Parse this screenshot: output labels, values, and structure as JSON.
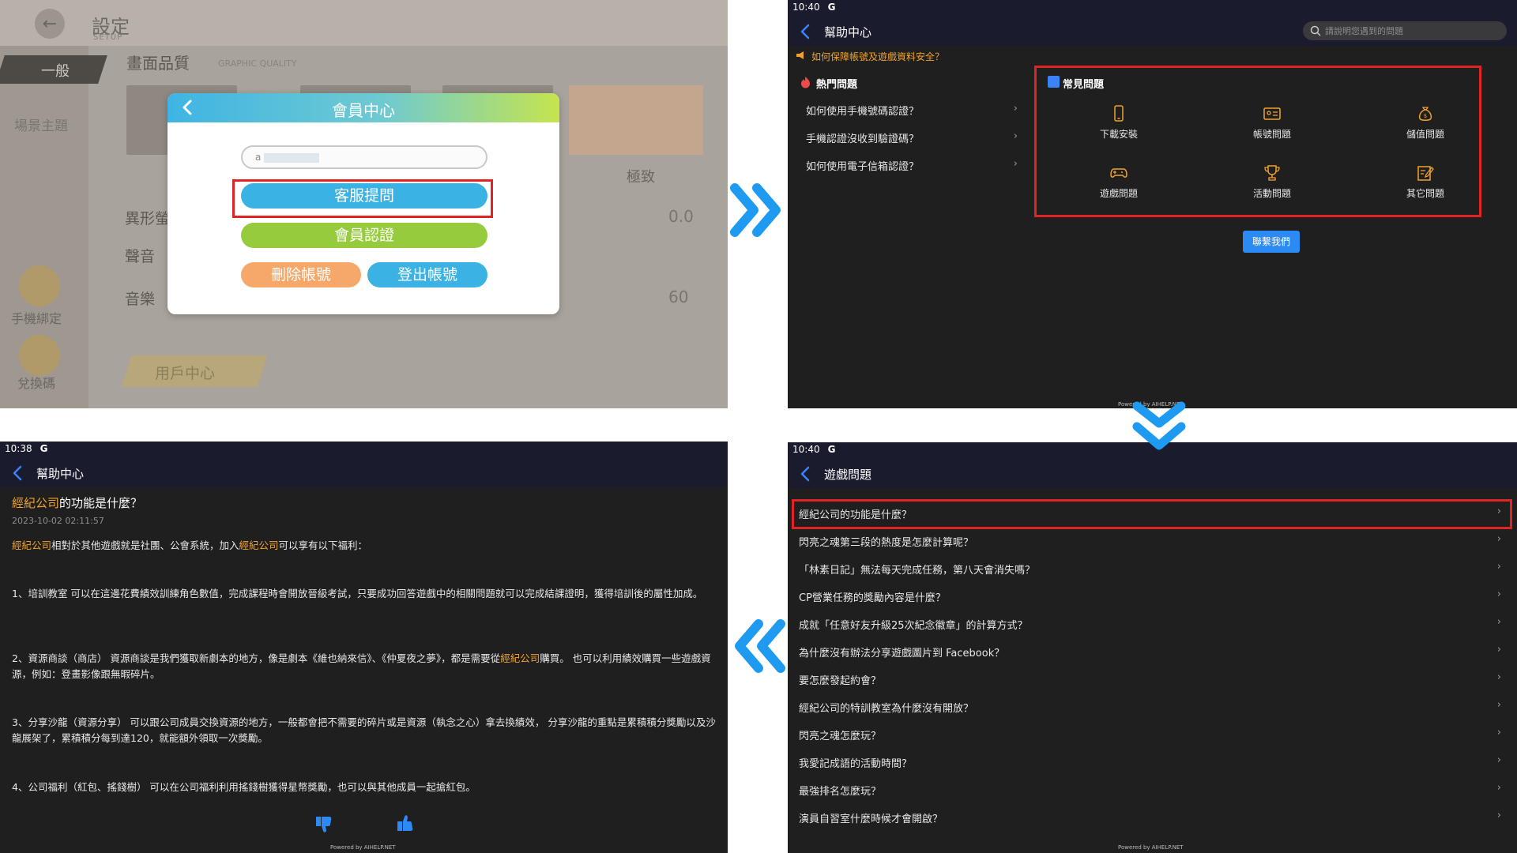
{
  "panel1": {
    "settings_title": "設定",
    "settings_sub": "SETUP",
    "nav_general": "一般",
    "nav_scene": "場景主題",
    "side_phone": "手機綁定",
    "side_redeem": "兌換碼",
    "section_title": "畫面品質",
    "section_sub": "GRAPHIC QUALITY",
    "quality_option": "極致",
    "rows": [
      {
        "label": "異形螢",
        "value": "0.0"
      },
      {
        "label": "聲音",
        "value": ""
      },
      {
        "label": "音樂",
        "value": "60"
      }
    ],
    "user_center": "用戶中心",
    "dialog": {
      "title": "會員中心",
      "account_prefix": "a",
      "btn_support": "客服提問",
      "btn_verify": "會員認證",
      "btn_delete": "刪除帳號",
      "btn_logout": "登出帳號"
    }
  },
  "panel2": {
    "time": "10:40",
    "g": "G",
    "title": "幫助中心",
    "search_placeholder": "請說明您遇到的問題",
    "notice": "如何保障帳號及遊戲資料安全？",
    "hot_title": "熱門問題",
    "hot_items": [
      "如何使用手機號碼認證？",
      "手機認證沒收到驗證碼？",
      "如何使用電子信箱認證？"
    ],
    "faq_title": "常見問題",
    "faq": [
      "下載安裝",
      "帳號問題",
      "儲值問題",
      "遊戲問題",
      "活動問題",
      "其它問題"
    ],
    "contact": "聯繫我們",
    "powered": "Powered by AIHELP.NET"
  },
  "panel3": {
    "time": "10:38",
    "g": "G",
    "title": "幫助中心",
    "article_title_hl": "經紀公司",
    "article_title_rest": "的功能是什麼？",
    "date": "2023-10-02 02:11:57",
    "intro": {
      "a": "經紀公司",
      "b": "相對於其他遊戲就是社團、公會系統，加入",
      "c": "經紀公司",
      "d": "可以享有以下福利："
    },
    "p1": "1、培訓教室 可以在這邊花費績效訓練角色數值，完成課程時會開放晉級考試，只要成功回答遊戲中的相關問題就可以完成結課證明，獲得培訓後的屬性加成。",
    "p2a": "2、資源商談（商店） 資源商談是我們獲取新劇本的地方，像是劇本《維也納來信》、《仲夏夜之夢》，都是需要從",
    "p2hl": "經紀公司",
    "p2b": "購買。 也可以利用績效購買一些遊戲資源，例如：登畫影像跟無暇碎片。",
    "p3": "3、分享沙龍（資源分享） 可以跟公司成員交換資源的地方，一般都會把不需要的碎片或是資源（執念之心）拿去換績效， 分享沙龍的重點是累積積分獎勵以及沙龍展架了，累積積分每到達120，就能額外領取一次獎勵。",
    "p4": "4、公司福利（紅包、搖錢樹） 可以在公司福利利用搖錢樹獲得星幣獎勵，也可以與其他成員一起搶紅包。",
    "powered": "Powered by AIHELP.NET"
  },
  "panel4": {
    "time": "10:40",
    "g": "G",
    "title": "遊戲問題",
    "questions": [
      "經紀公司的功能是什麼？",
      "閃亮之魂第三段的熱度是怎麼計算呢？",
      "「林素日記」無法每天完成任務，第八天會消失嗎？",
      "CP營業任務的獎勵內容是什麼？",
      "成就「任意好友升級25次紀念徽章」的計算方式？",
      "為什麼沒有辦法分享遊戲圖片到 Facebook？",
      "要怎麼發起約會？",
      "經紀公司的特訓教室為什麼沒有開放？",
      "閃亮之魂怎麼玩？",
      "我愛記成語的活動時間？",
      "最強排名怎麼玩？",
      "演員自習室什麼時候才會開啟？"
    ],
    "powered": "Powered by AIHELP.NET"
  },
  "colors": {
    "highlight_red": "#e02424",
    "accent_orange": "#f0a22c",
    "arrow_blue": "#1e9af0",
    "contact_blue": "#2b8af3"
  }
}
